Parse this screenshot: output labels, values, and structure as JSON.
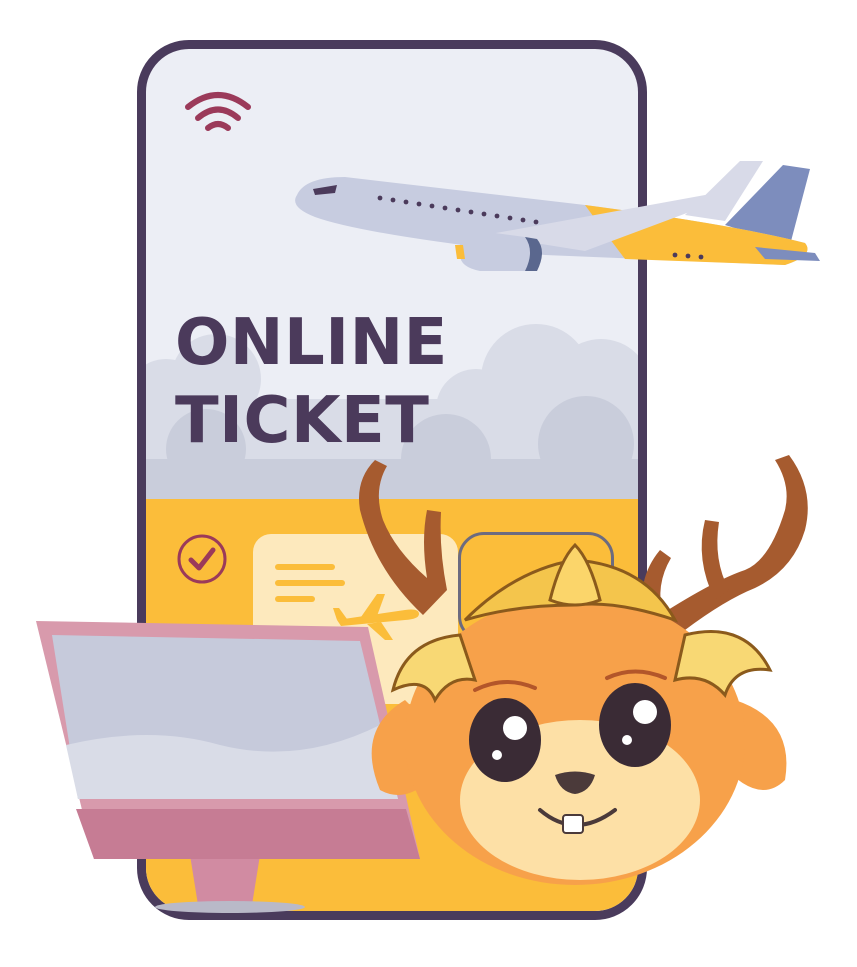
{
  "title": {
    "line1": "ONLINE",
    "line2": "TICKET"
  },
  "icons": {
    "wifi": "wifi-icon",
    "check": "check-circle-icon",
    "plane": "airplane-icon"
  },
  "colors": {
    "phone_frame": "#4a3b5c",
    "screen_bg": "#eceef5",
    "accent_yellow": "#fbbd3a",
    "title_text": "#4b3a5b",
    "wifi": "#9b3a5a",
    "monitor_pink": "#d89aac"
  }
}
